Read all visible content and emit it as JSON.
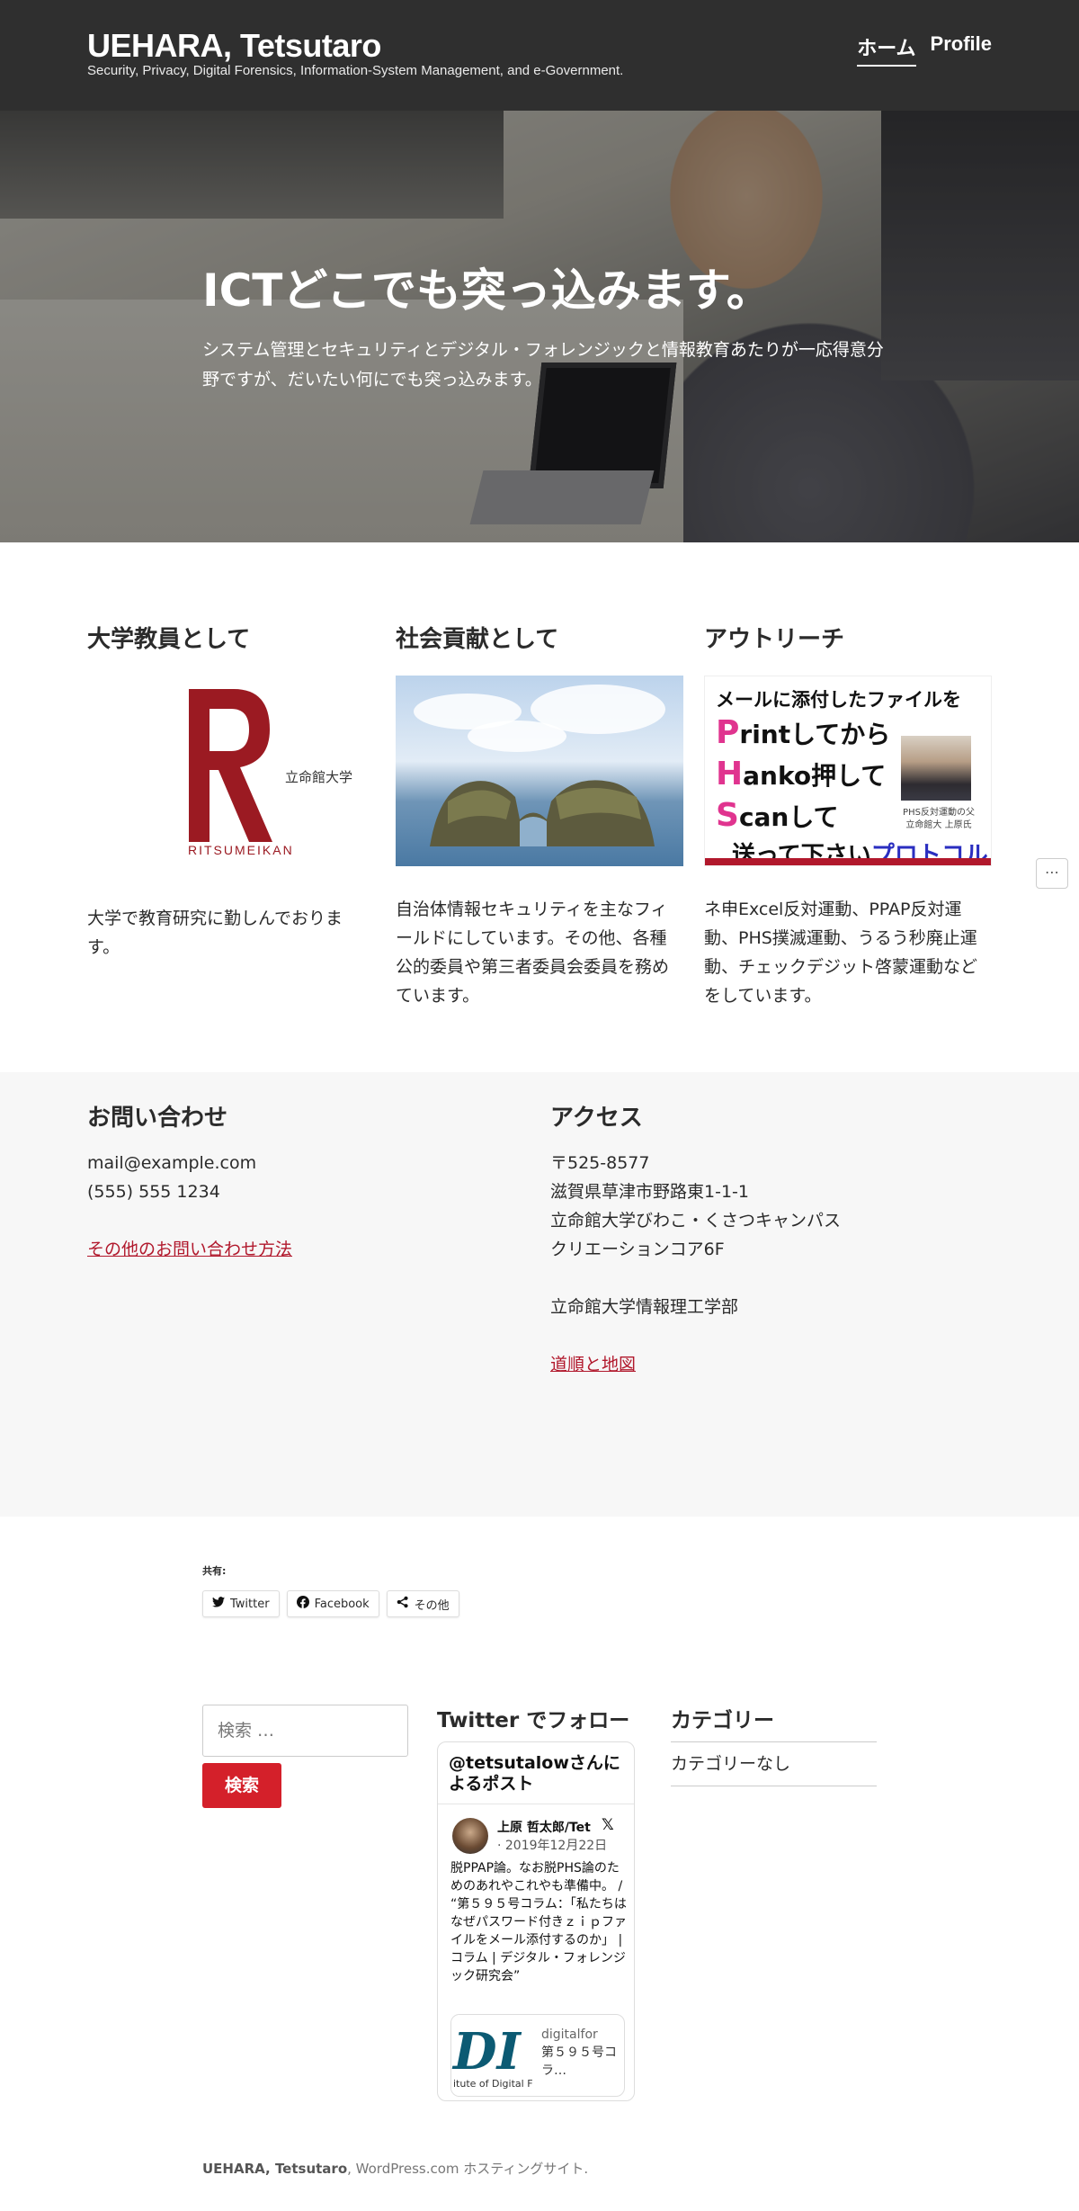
{
  "header": {
    "title": "UEHARA, Tetsutaro",
    "description": "Security, Privacy, Digital Forensics, Information-System Management, and e-Government.",
    "nav": [
      {
        "label": "ホーム",
        "active": true
      },
      {
        "label": "Profile",
        "active": false
      }
    ]
  },
  "hero": {
    "title": "ICTどこでも突っ込みます。",
    "text": "システム管理とセキュリティとデジタル・フォレンジックと情報教育あたりが一応得意分野ですが、だいたい何にでも突っ込みます。"
  },
  "columns": [
    {
      "heading": "大学教員として",
      "text": "大学で教育研究に勤しんでおります。"
    },
    {
      "heading": "社会貢献として",
      "text": "自治体情報セキュリティを主なフィールドにしています。その他、各種公的委員や第三者委員会委員を務めています。"
    },
    {
      "heading": "アウトリーチ",
      "text": "ネ申Excel反対運動、PPAP反対運動、PHS撲滅運動、うるう秒廃止運動、チェックデジット啓蒙運動などをしています。"
    }
  ],
  "ritsumeikan_logo": {
    "name": "RITSUMEIKAN",
    "univ": "立命館大学"
  },
  "outreach_image": {
    "title": "メールに添付したファイルを",
    "lines": [
      {
        "initial": "P",
        "rest": "rintしてから"
      },
      {
        "initial": "H",
        "rest": "anko押して"
      },
      {
        "initial": "S",
        "rest": "canして"
      }
    ],
    "last_plain": "送って下さい",
    "last_blue": "プロトコル",
    "caption": "PHS反対運動の父\n立命館大 上原氏"
  },
  "more_button": "⋯",
  "contact": {
    "heading": "お問い合わせ",
    "email": "mail@example.com",
    "phone": "(555) 555 1234",
    "link": "その他のお問い合わせ方法"
  },
  "access": {
    "heading": "アクセス",
    "postal": "〒525-8577",
    "address1": "滋賀県草津市野路東1-1-1",
    "address2": "立命館大学びわこ・くさつキャンパス",
    "address3": "クリエーションコア6F",
    "dept": "立命館大学情報理工学部",
    "link": "道順と地図"
  },
  "share": {
    "label": "共有:",
    "buttons": [
      {
        "icon": "twitter-icon",
        "label": "Twitter"
      },
      {
        "icon": "facebook-icon",
        "label": "Facebook"
      },
      {
        "icon": "share-icon",
        "label": "その他"
      }
    ]
  },
  "search": {
    "placeholder": "検索 …",
    "button": "検索"
  },
  "twitter": {
    "heading": "Twitter でフォロー",
    "card_title": "@tetsutalowさんによるポスト",
    "user": "上原 哲太郎/Tet",
    "date": "· 2019年12月22日",
    "body": "脱PPAP論。なお脱PHS論のためのあれやこれやも準備中。 / “第５９５号コラム：「私たちはなぜパスワード付きｚｉｐファイルをメール添付するのか」 | コラム | デジタル・フォレンジック研究会”",
    "link_logo": "DI",
    "link_logo_sub": "itute of Digital F",
    "link_domain": "digitalfor",
    "link_text": "第５９５号コラ…"
  },
  "categories": {
    "heading": "カテゴリー",
    "items": [
      "カテゴリーなし"
    ]
  },
  "footer": {
    "site": "UEHARA, Tetsutaro",
    "text": ", WordPress.com ホスティングサイト."
  }
}
